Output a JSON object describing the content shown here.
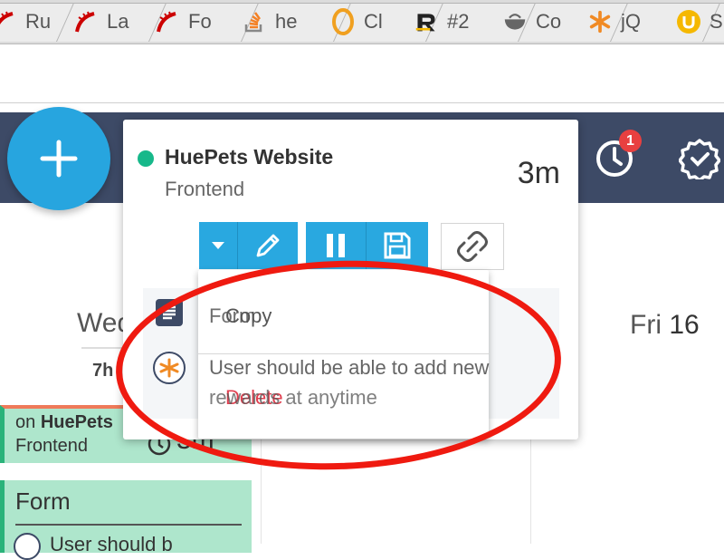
{
  "browser": {
    "tabs": [
      {
        "label": "Ru",
        "icon": "rails-icon",
        "color": "#cc0000"
      },
      {
        "label": "La",
        "icon": "rails-icon",
        "color": "#cc0000"
      },
      {
        "label": "Fo",
        "icon": "rails-icon",
        "color": "#cc0000"
      },
      {
        "label": "he",
        "icon": "stackoverflow-icon",
        "color": "#f48024"
      },
      {
        "label": "Cl",
        "icon": "opera-o-icon",
        "color": "#f0a020"
      },
      {
        "label": "#2",
        "icon": "r-logo-icon",
        "color": "#222222"
      },
      {
        "label": "Co",
        "icon": "bowl-icon",
        "color": "#666666"
      },
      {
        "label": "jQ",
        "icon": "asterisk-icon",
        "color": "#f08a24"
      },
      {
        "label": "S",
        "icon": "u-badge-icon",
        "color": "#f5b800"
      }
    ]
  },
  "header": {
    "add_icon": "plus-icon",
    "notification_count": "1",
    "icons": [
      "clock-icon",
      "badge-check-icon"
    ],
    "color": "#3d4a66",
    "fab_color": "#27a5df"
  },
  "calendar": {
    "day_wed_name": "Wed",
    "wed_hours": "7h",
    "day_fri_name": "Fri",
    "day_fri_num": "16",
    "event1_prefix": "on ",
    "event1_project": "HuePets",
    "event1_task": "Frontend",
    "event1_duration": "3m",
    "event2_title": "Form",
    "event2_snippet": "User should b"
  },
  "timer_card": {
    "project": "HuePets Website",
    "task": "Frontend",
    "duration": "3m",
    "status_color": "#17b88a",
    "buttons": [
      "chevron-down-icon",
      "pencil-icon",
      "pause-icon",
      "save-icon",
      "unlink-icon"
    ],
    "row1_text": "Form",
    "row2_text_line1": "User should be able to add new",
    "row2_text_line2": "rewards at anytime"
  },
  "dropdown": {
    "copy_label": "Copy",
    "delete_label": "Delete",
    "delete_color": "#e04050"
  },
  "annotation": {
    "color": "#ef1a10"
  }
}
